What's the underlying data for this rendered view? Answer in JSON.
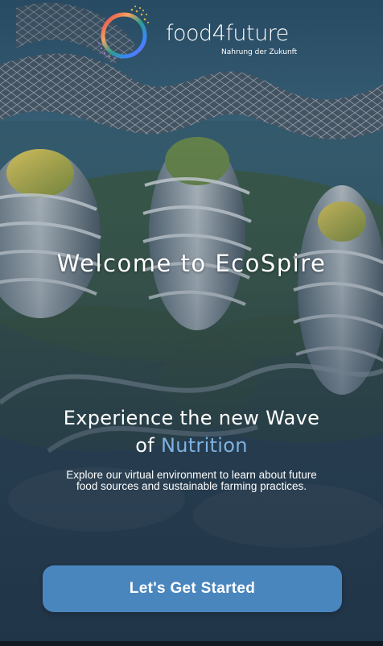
{
  "logo": {
    "name": "food4future",
    "tagline": "Nahrung der Zukunft"
  },
  "welcome": {
    "title": "Welcome to EcoSpire"
  },
  "headline": {
    "line1": "Experience the new Wave",
    "line2_prefix": "of ",
    "line2_accent": "Nutrition"
  },
  "description": {
    "text": "Explore our virtual environment to learn about future food sources and sustainable farming practices."
  },
  "cta": {
    "label": "Let's Get Started"
  },
  "colors": {
    "accent": "#7fb2e0",
    "button": "#4a86be",
    "overlay": "#2a4560"
  },
  "icons": {
    "logo": "food4future-ring-logo"
  }
}
